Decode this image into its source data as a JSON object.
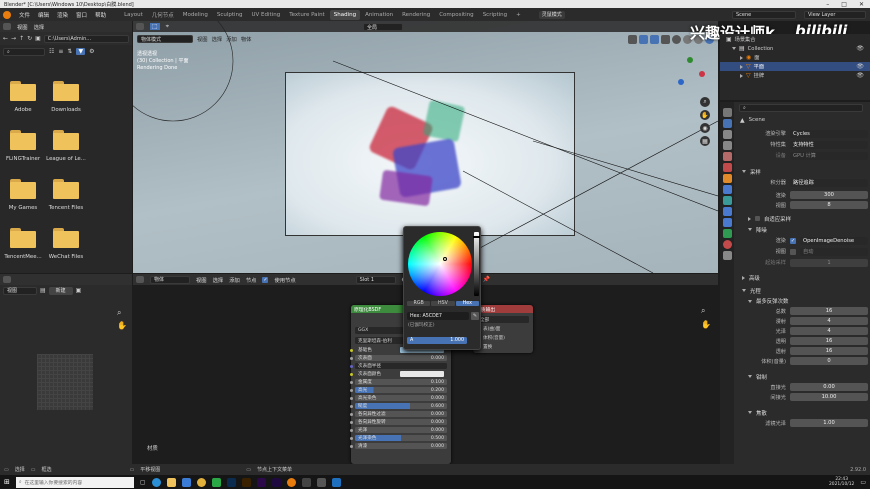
{
  "window": {
    "title": "Blender* [C:\\Users\\Windows 10\\Desktop\\白膜.blend]"
  },
  "menu": {
    "items": [
      "文件",
      "编辑",
      "渲染",
      "窗口",
      "帮助"
    ]
  },
  "workspaces": [
    "Layout",
    "几何节点",
    "Modeling",
    "Scripting",
    "UV Editing",
    "Texture Paint",
    "Shading",
    "Animation",
    "Rendering",
    "Compositing",
    "Scripting"
  ],
  "active_workspace": "Shading",
  "topbar": {
    "preset": "灵鼠模式",
    "scene": "Scene",
    "view_layer": "View Layer"
  },
  "watermark": {
    "text": "兴趣设计师k"
  },
  "filebrowser": {
    "header": [
      "视图",
      "选择"
    ],
    "path": "C:\\Users\\Admin...",
    "items": [
      "Adobe",
      "Downloads",
      "FLiNGTrainer",
      "League of Le...",
      "My Games",
      "Tencent Files",
      "TencentMee...",
      "WeChat Files"
    ]
  },
  "viewport": {
    "mode": "物体模式",
    "menus": [
      "视图",
      "选择",
      "添加",
      "物体"
    ],
    "transform": "全局",
    "overlay_text": [
      "透视透视",
      "(30) Collection | 平面",
      "Rendering Done"
    ]
  },
  "outliner": {
    "root": "场景集合",
    "collection": "Collection",
    "items": [
      "面",
      "平面",
      "挂牌"
    ]
  },
  "properties": {
    "scene_name": "Scene",
    "engine_label": "渲染引擎",
    "engine": "Cycles",
    "feature_label": "特性集",
    "feature": "支持特性",
    "device_label": "设备",
    "device": "GPU 计算",
    "sampling_title": "采样",
    "integrator_label": "积分器",
    "integrator": "路径追踪",
    "render_label": "渲染",
    "render_samples": "300",
    "viewport_label": "视图",
    "viewport_samples": "8",
    "adaptive_label": "自适应采样",
    "denoise_title": "降噪",
    "denoise_render_label": "渲染",
    "denoiser": "OpenImageDenoise",
    "denoise_viewport_label": "视图",
    "denoise_viewport": "自动",
    "start_sample_label": "起始采样",
    "start_sample": "1",
    "advanced_title": "高级",
    "lightpaths_title": "光程",
    "max_bounces_title": "最多反弹次数",
    "bounces": [
      {
        "label": "总数",
        "value": "16"
      },
      {
        "label": "漫射",
        "value": "4"
      },
      {
        "label": "光泽",
        "value": "4"
      },
      {
        "label": "透明",
        "value": "16"
      },
      {
        "label": "透射",
        "value": "16"
      },
      {
        "label": "体积(音量)",
        "value": "0"
      }
    ],
    "clamping_title": "钳制",
    "direct_label": "直接光",
    "direct": "0.00",
    "indirect_label": "间接光",
    "indirect": "10.00",
    "caustics_title": "焦散",
    "filter_glossy_label": "滤镜光泽",
    "filter_glossy": "1.00"
  },
  "node_editor": {
    "header": [
      "物体",
      "视图",
      "选择",
      "添加",
      "节点"
    ],
    "use_nodes_label": "使用节点",
    "slot": "Slot 1",
    "new_label": "新建",
    "material_label": "材质",
    "bsdf_node": {
      "title": "原理化BSDF",
      "distribution": "GGX",
      "subsurface_method": "克里斯坦森-伯利",
      "rows": [
        {
          "label": "基础色",
          "value": ""
        },
        {
          "label": "次表面",
          "value": "0.000"
        },
        {
          "label": "次表面半径",
          "value": ""
        },
        {
          "label": "次表面颜色",
          "value": ""
        },
        {
          "label": "金属度",
          "value": "0.100"
        },
        {
          "label": "高光",
          "value": "0.200"
        },
        {
          "label": "高光染色",
          "value": "0.000"
        },
        {
          "label": "糙度",
          "value": "0.600"
        },
        {
          "label": "各向异性过滤",
          "value": "0.000"
        },
        {
          "label": "各向异性旋转",
          "value": "0.000"
        },
        {
          "label": "光泽",
          "value": "0.000"
        },
        {
          "label": "光泽染色",
          "value": "0.500"
        },
        {
          "label": "清漆",
          "value": "0.000"
        }
      ]
    },
    "output_node": {
      "title": "材质输出",
      "target": "全部",
      "rows": [
        "表(曲)面",
        "体积(音量)",
        "置换"
      ]
    }
  },
  "color_picker": {
    "tabs": [
      "RGB",
      "HSV",
      "Hex"
    ],
    "active_tab": "Hex",
    "hex_label": "Hex: A5CDE7",
    "gamma_note": "(已伽玛校正)",
    "alpha_label": "A",
    "alpha_value": "1.000",
    "color": "#A5CDE7"
  },
  "image_editor": {
    "header": "视图"
  },
  "statusbar": {
    "items": [
      "选择",
      "框选",
      "平移视图",
      "节点上下文菜单"
    ],
    "version": "2.92.0"
  },
  "taskbar": {
    "search_placeholder": "在这里输入你要搜索的内容",
    "time": "22:43",
    "date": "2021/10/12"
  },
  "colors": {
    "accent": "#4772b3",
    "folder": "#efc25b",
    "node_header_bsdf": "#3d8c3d",
    "node_header_output": "#a13c3c"
  }
}
